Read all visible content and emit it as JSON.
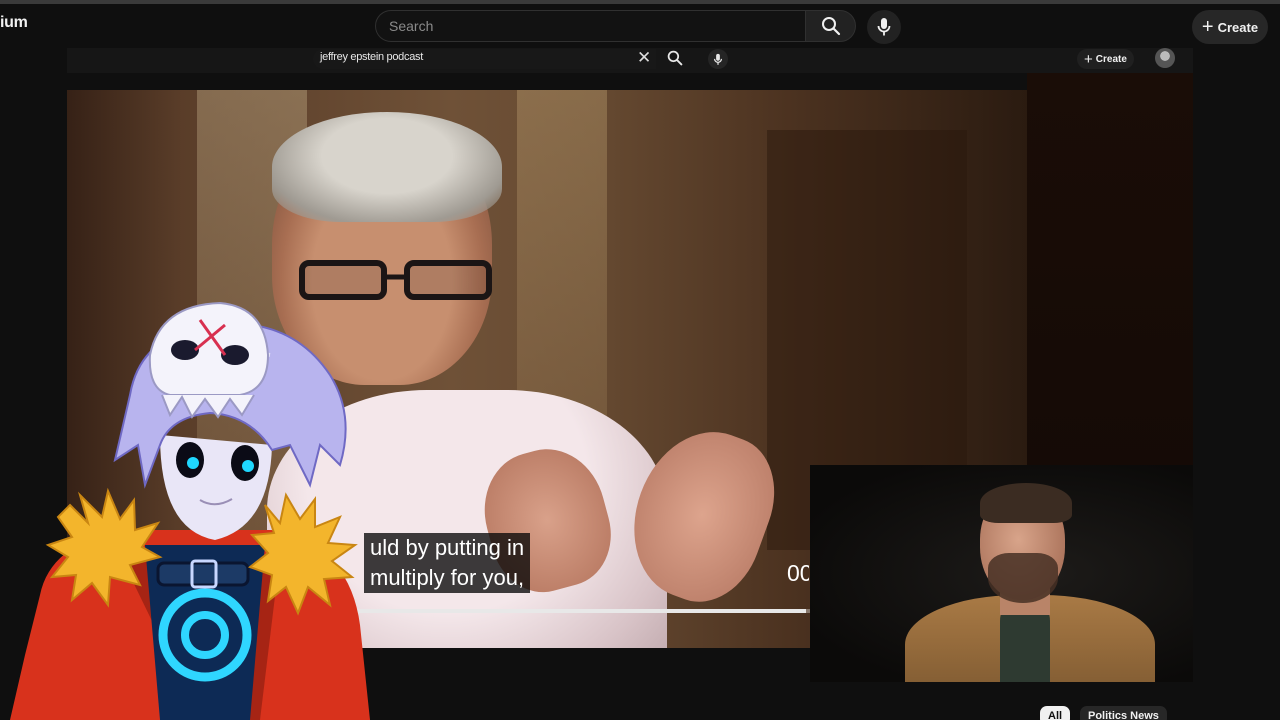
{
  "masthead": {
    "brand_fragment": "ium",
    "search_placeholder": "Search",
    "create_label": "Create"
  },
  "inner_screen": {
    "search_query": "jeffrey epstein podcast",
    "create_label": "Create"
  },
  "video": {
    "caption_line1": "uld by putting in",
    "caption_line2": "multiply for you,",
    "timecode_fragment": "00",
    "progress_fraction": 0.67
  },
  "chips": {
    "all": "All",
    "politics": "Politics News"
  },
  "colors": {
    "background": "#0f0f0f",
    "chip_selected": "#f1f1f1",
    "chip_default": "#272727"
  }
}
